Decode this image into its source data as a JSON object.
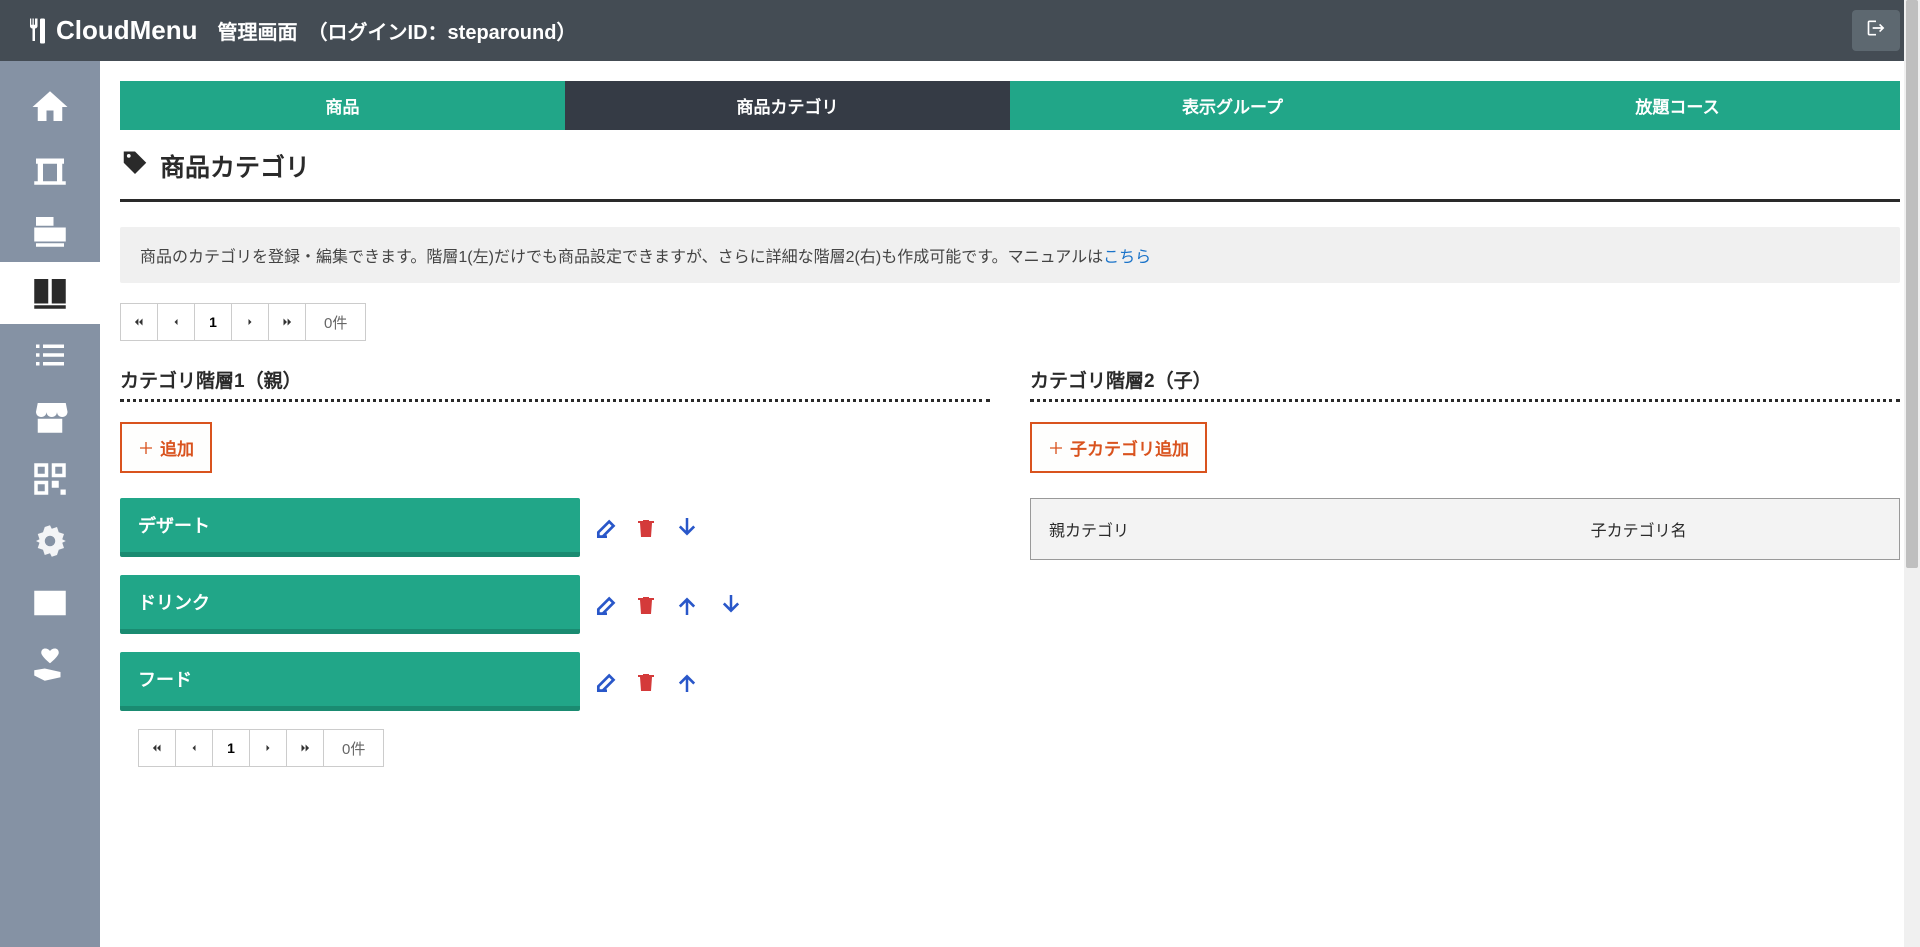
{
  "header": {
    "logo_text": "CloudMenu",
    "title_prefix": "管理画面　（ログインID：",
    "login_id": "steparound",
    "title_suffix": "）"
  },
  "tabs": [
    {
      "label": "商品",
      "active": false
    },
    {
      "label": "商品カテゴリ",
      "active": true
    },
    {
      "label": "表示グループ",
      "active": false
    },
    {
      "label": "放題コース",
      "active": false
    }
  ],
  "page_title": "商品カテゴリ",
  "info": {
    "text": "商品のカテゴリを登録・編集できます。階層1(左)だけでも商品設定できますが、さらに詳細な階層2(右)も作成可能です。マニュアルは",
    "link_text": "こちら"
  },
  "pagination": {
    "current_page": "1",
    "count_text": "0件"
  },
  "left_column": {
    "title": "カテゴリ階層1（親）",
    "add_button": "追加",
    "items": [
      {
        "name": "デザート",
        "can_up": false,
        "can_down": true
      },
      {
        "name": "ドリンク",
        "can_up": true,
        "can_down": true
      },
      {
        "name": "フード",
        "can_up": true,
        "can_down": false
      }
    ]
  },
  "right_column": {
    "title": "カテゴリ階層2（子）",
    "add_button": "子カテゴリ追加",
    "table": {
      "col1": "親カテゴリ",
      "col2": "子カテゴリ名"
    }
  }
}
